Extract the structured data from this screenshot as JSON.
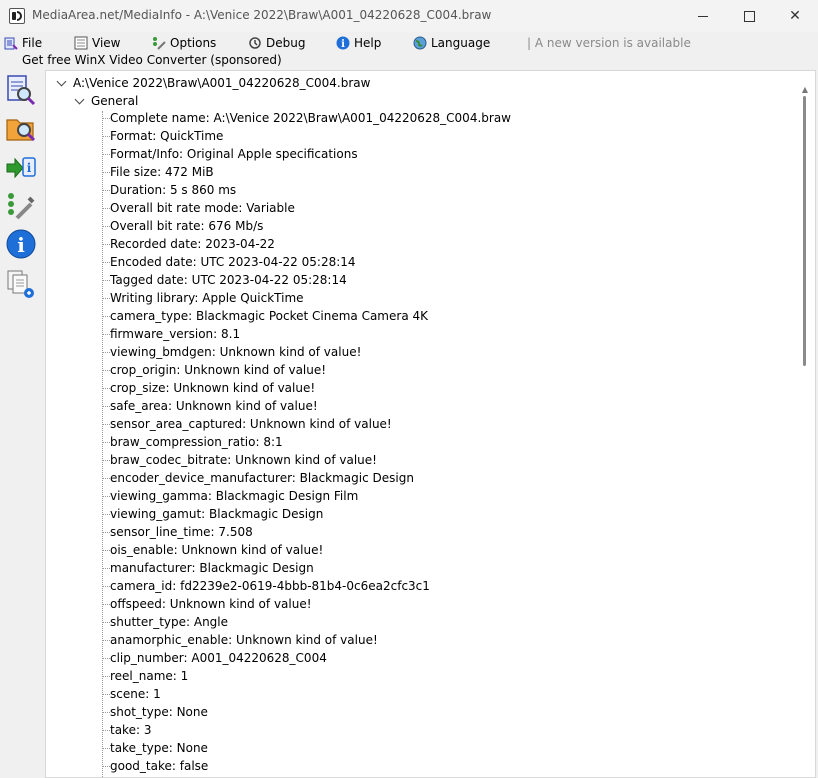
{
  "window": {
    "title": "MediaArea.net/MediaInfo - A:\\Venice 2022\\Braw\\A001_04220628_C004.braw",
    "app_icon": "mediainfo-icon",
    "controls": {
      "minimize": "minimize-icon",
      "maximize": "maximize-icon",
      "close_glyph": "✕"
    }
  },
  "menu": {
    "items": [
      {
        "label": "File",
        "icon": "file-icon"
      },
      {
        "label": "View",
        "icon": "view-icon"
      },
      {
        "label": "Options",
        "icon": "options-icon"
      },
      {
        "label": "Debug",
        "icon": "debug-icon"
      },
      {
        "label": "Help",
        "icon": "help-icon"
      },
      {
        "label": "Language",
        "icon": "globe-icon"
      }
    ],
    "update_notice": "| A new version is available"
  },
  "sponsor_link": "Get free WinX Video Converter (sponsored)",
  "sidebar": {
    "buttons": [
      "open-file-icon",
      "open-folder-icon",
      "export-icon",
      "preferences-icon",
      "about-icon",
      "knowledge-base-icon"
    ]
  },
  "tree": {
    "root": "A:\\Venice 2022\\Braw\\A001_04220628_C004.braw",
    "section": "General",
    "rows": [
      "Complete name: A:\\Venice 2022\\Braw\\A001_04220628_C004.braw",
      "Format: QuickTime",
      "Format/Info: Original Apple specifications",
      "File size: 472 MiB",
      "Duration: 5 s 860 ms",
      "Overall bit rate mode: Variable",
      "Overall bit rate: 676 Mb/s",
      "Recorded date: 2023-04-22",
      "Encoded date: UTC 2023-04-22 05:28:14",
      "Tagged date: UTC 2023-04-22 05:28:14",
      "Writing library: Apple QuickTime",
      "camera_type: Blackmagic Pocket Cinema Camera 4K",
      "firmware_version: 8.1",
      "viewing_bmdgen: Unknown kind of value!",
      "crop_origin: Unknown kind of value!",
      "crop_size: Unknown kind of value!",
      "safe_area: Unknown kind of value!",
      "sensor_area_captured: Unknown kind of value!",
      "braw_compression_ratio: 8:1",
      "braw_codec_bitrate: Unknown kind of value!",
      "encoder_device_manufacturer: Blackmagic Design",
      "viewing_gamma: Blackmagic Design Film",
      "viewing_gamut: Blackmagic Design",
      "sensor_line_time: 7.508",
      "ois_enable: Unknown kind of value!",
      "manufacturer: Blackmagic Design",
      "camera_id: fd2239e2-0619-4bbb-81b4-0c6ea2cfc3c1",
      "offspeed: Unknown kind of value!",
      "shutter_type: Angle",
      "anamorphic_enable: Unknown kind of value!",
      "clip_number: A001_04220628_C004",
      "reel_name: 1",
      "scene: 1",
      "shot_type: None",
      "take: 3",
      "take_type: None",
      "good_take: false"
    ]
  },
  "colors": {
    "window_bg": "#f0f0f0",
    "content_bg": "#ffffff",
    "update_notice": "#8a8a8a"
  }
}
